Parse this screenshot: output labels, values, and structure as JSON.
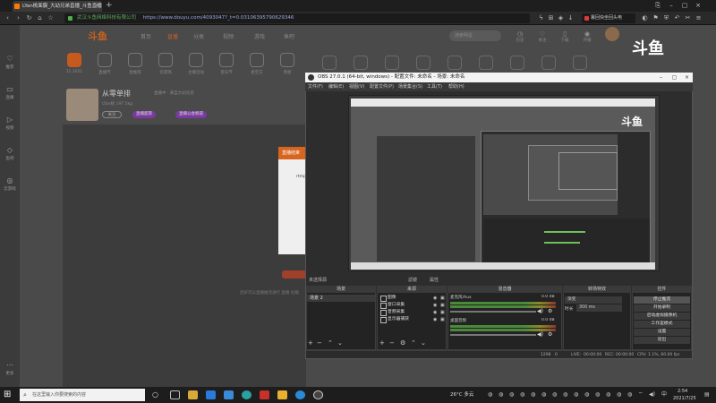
{
  "browser": {
    "tab_title": "LYan桃面膜_大幼兄弟直播_斗鱼直播",
    "cert_text": "武汉斗鱼网络科技有限公司",
    "url": "https://www.douyu.com/4093047?_t=0.03106395790629346",
    "news_label": "篡回快坐回头电"
  },
  "sidebar": {
    "items": [
      {
        "label": "推荐"
      },
      {
        "label": "直播"
      },
      {
        "label": "视频"
      },
      {
        "label": "鱼吧"
      },
      {
        "label": "云游戏"
      },
      {
        "label": "更多"
      }
    ]
  },
  "site": {
    "logo": "斗鱼",
    "nav": {
      "home": "首页",
      "live": "直播",
      "category": "分类",
      "video": "视频",
      "game": "游戏",
      "yuba": "鱼吧"
    },
    "search_placeholder": "搜索明星",
    "header_icons": [
      "历史",
      "关注",
      "下载",
      "开播"
    ],
    "categories": [
      {
        "label": "11 2021"
      },
      {
        "label": "直播节"
      },
      {
        "label": "星推荐"
      },
      {
        "label": "云游戏"
      },
      {
        "label": "主播活动"
      },
      {
        "label": "音乐节"
      },
      {
        "label": "星空方"
      },
      {
        "label": "周星"
      }
    ],
    "room_name": "从零单排",
    "room_subtitle": "直播中 · 来自大幼兄弟",
    "room_meta": "LYan桃  197  5kg",
    "follow_label": "关注",
    "tags": [
      "直播超管",
      "直播公会频道"
    ],
    "popup_title": "直播结束",
    "popup_body": "rtmp",
    "player_hint": "您好可以直播推流进行 直播 投稿",
    "brand_overlay": "斗鱼"
  },
  "obs": {
    "title": "OBS 27.0.1 (64-bit, windows) - 配置文件: 未命名 - 场景: 未命名",
    "menu": [
      "文件(F)",
      "编辑(E)",
      "视图(V)",
      "配置文件(P)",
      "场景集合(S)",
      "工具(T)",
      "帮助(H)"
    ],
    "preview_logo": "斗鱼",
    "no_source": "未选择源",
    "filters_label": "滤镜",
    "props_label": "属性",
    "docks": {
      "scenes": "场景",
      "sources": "来源",
      "mixer": "混音器",
      "transitions": "转场特效",
      "controls": "控件"
    },
    "scene_items": [
      "场景 2"
    ],
    "sources": [
      {
        "name": "图像",
        "icon": "image-icon"
      },
      {
        "name": "窗口采集",
        "icon": "window-icon"
      },
      {
        "name": "音频采集",
        "icon": "audio-icon"
      },
      {
        "name": "显示器捕获",
        "icon": "monitor-icon"
      }
    ],
    "mixer": [
      {
        "name": "麦克风/Aux",
        "db": "0.0 dB",
        "level": 0.72
      },
      {
        "name": "桌面音频",
        "db": "0.0 dB",
        "level": 0.68
      }
    ],
    "transition": {
      "type": "渐变",
      "duration_label": "时长",
      "duration": "300 ms"
    },
    "controls": [
      "停止推流",
      "开始录制",
      "启动虚拟摄像机",
      "工作室模式",
      "设置",
      "退出"
    ],
    "status": {
      "dropped": "0",
      "live_label": "LIVE:",
      "live_time": "00:00:00",
      "rec_label": "REC:",
      "rec_time": "00:00:00",
      "cpu": "CPU: 1.1%, 60.00 fps",
      "kbps": "1298"
    }
  },
  "taskbar": {
    "search_placeholder": "在这里输入你要搜索的内容",
    "weather": "26°C 多云",
    "time": "2:54",
    "date": "2021/7/25"
  }
}
